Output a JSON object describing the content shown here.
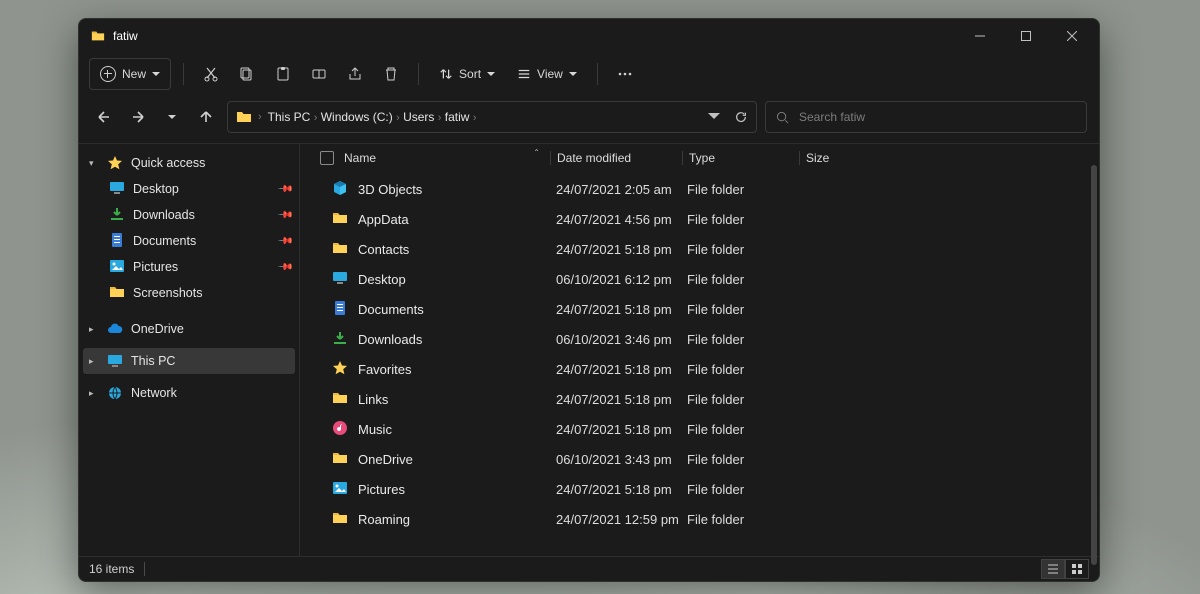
{
  "title": "fatiw",
  "toolbar": {
    "new_label": "New",
    "sort_label": "Sort",
    "view_label": "View"
  },
  "breadcrumbs": [
    "This PC",
    "Windows (C:)",
    "Users",
    "fatiw"
  ],
  "search": {
    "placeholder": "Search fatiw"
  },
  "columns": {
    "name": "Name",
    "date": "Date modified",
    "type": "Type",
    "size": "Size"
  },
  "sidebar": {
    "quick": "Quick access",
    "quick_items": [
      {
        "label": "Desktop",
        "icon": "desktop"
      },
      {
        "label": "Downloads",
        "icon": "download"
      },
      {
        "label": "Documents",
        "icon": "document"
      },
      {
        "label": "Pictures",
        "icon": "pictures"
      },
      {
        "label": "Screenshots",
        "icon": "folder"
      }
    ],
    "onedrive": "OneDrive",
    "thispc": "This PC",
    "network": "Network"
  },
  "rows": [
    {
      "name": "3D Objects",
      "date": "24/07/2021 2:05 am",
      "type": "File folder",
      "icon": "cube3d"
    },
    {
      "name": "AppData",
      "date": "24/07/2021 4:56 pm",
      "type": "File folder",
      "icon": "folder"
    },
    {
      "name": "Contacts",
      "date": "24/07/2021 5:18 pm",
      "type": "File folder",
      "icon": "folder"
    },
    {
      "name": "Desktop",
      "date": "06/10/2021 6:12 pm",
      "type": "File folder",
      "icon": "desktop"
    },
    {
      "name": "Documents",
      "date": "24/07/2021 5:18 pm",
      "type": "File folder",
      "icon": "document"
    },
    {
      "name": "Downloads",
      "date": "06/10/2021 3:46 pm",
      "type": "File folder",
      "icon": "download"
    },
    {
      "name": "Favorites",
      "date": "24/07/2021 5:18 pm",
      "type": "File folder",
      "icon": "star"
    },
    {
      "name": "Links",
      "date": "24/07/2021 5:18 pm",
      "type": "File folder",
      "icon": "folder"
    },
    {
      "name": "Music",
      "date": "24/07/2021 5:18 pm",
      "type": "File folder",
      "icon": "music"
    },
    {
      "name": "OneDrive",
      "date": "06/10/2021 3:43 pm",
      "type": "File folder",
      "icon": "folder"
    },
    {
      "name": "Pictures",
      "date": "24/07/2021 5:18 pm",
      "type": "File folder",
      "icon": "pictures"
    },
    {
      "name": "Roaming",
      "date": "24/07/2021 12:59 pm",
      "type": "File folder",
      "icon": "folder"
    }
  ],
  "status": {
    "count": "16 items"
  }
}
